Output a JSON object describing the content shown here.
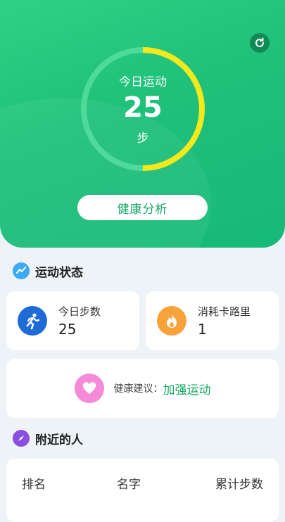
{
  "hero": {
    "today_label": "今日运动",
    "steps_value": "25",
    "steps_unit": "步",
    "progress_fraction": 0.5,
    "analysis_button": "健康分析",
    "colors": {
      "ring_track": "#4fd99a",
      "ring_progress": "#f6e81b"
    }
  },
  "status": {
    "title": "运动状态",
    "today_steps_label": "今日步数",
    "today_steps_value": "25",
    "calories_label": "消耗卡路里",
    "calories_value": "1"
  },
  "advice": {
    "label": "健康建议：",
    "value": "加强运动"
  },
  "nearby": {
    "title": "附近的人",
    "columns": [
      "排名",
      "名字",
      "累计步数"
    ]
  },
  "icons": [
    "refresh-icon",
    "pulse-icon",
    "running-person-icon",
    "flame-icon",
    "heart-icon",
    "compass-icon"
  ]
}
